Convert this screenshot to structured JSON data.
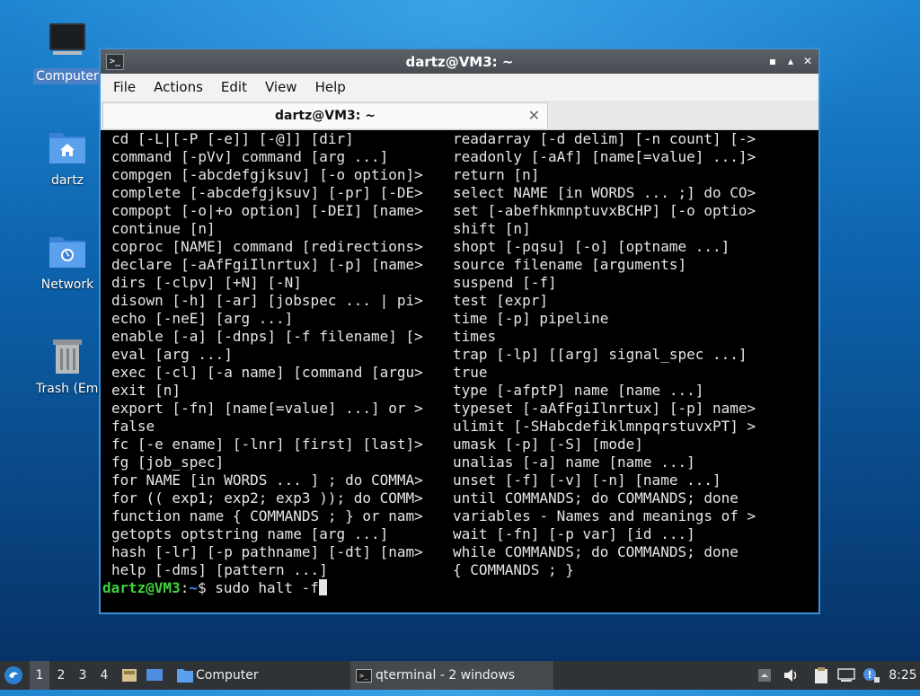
{
  "desktop": {
    "icons": [
      {
        "label": "Computer",
        "icon": "computer-icon",
        "selected": true
      },
      {
        "label": "dartz",
        "icon": "home-folder-icon"
      },
      {
        "label": "Network",
        "icon": "network-folder-icon"
      },
      {
        "label": "Trash (Empt",
        "icon": "trash-icon"
      }
    ]
  },
  "window": {
    "title": "dartz@VM3: ~",
    "controls": {
      "minimize": "▪",
      "maximize": "▴",
      "close": "✕"
    },
    "menu": [
      "File",
      "Actions",
      "Edit",
      "View",
      "Help"
    ],
    "tab": {
      "label": "dartz@VM3: ~",
      "close": "✕"
    }
  },
  "terminal": {
    "left_column": [
      "cd [-L|[-P [-e]] [-@]] [dir]",
      "command [-pVv] command [arg ...]",
      "compgen [-abcdefgjksuv] [-o option]>",
      "complete [-abcdefgjksuv] [-pr] [-DE>",
      "compopt [-o|+o option] [-DEI] [name>",
      "continue [n]",
      "coproc [NAME] command [redirections>",
      "declare [-aAfFgiIlnrtux] [-p] [name>",
      "dirs [-clpv] [+N] [-N]",
      "disown [-h] [-ar] [jobspec ... | pi>",
      "echo [-neE] [arg ...]",
      "enable [-a] [-dnps] [-f filename] [>",
      "eval [arg ...]",
      "exec [-cl] [-a name] [command [argu>",
      "exit [n]",
      "export [-fn] [name[=value] ...] or >",
      "false",
      "fc [-e ename] [-lnr] [first] [last]>",
      "fg [job_spec]",
      "for NAME [in WORDS ... ] ; do COMMA>",
      "for (( exp1; exp2; exp3 )); do COMM>",
      "function name { COMMANDS ; } or nam>",
      "getopts optstring name [arg ...]",
      "hash [-lr] [-p pathname] [-dt] [nam>",
      "help [-dms] [pattern ...]"
    ],
    "right_column": [
      "readarray [-d delim] [-n count] [->",
      "readonly [-aAf] [name[=value] ...]>",
      "return [n]",
      "select NAME [in WORDS ... ;] do CO>",
      "set [-abefhkmnptuvxBCHP] [-o optio>",
      "shift [n]",
      "shopt [-pqsu] [-o] [optname ...]",
      "source filename [arguments]",
      "suspend [-f]",
      "test [expr]",
      "time [-p] pipeline",
      "times",
      "trap [-lp] [[arg] signal_spec ...]",
      "true",
      "type [-afptP] name [name ...]",
      "typeset [-aAfFgiIlnrtux] [-p] name>",
      "ulimit [-SHabcdefiklmnpqrstuvxPT] >",
      "umask [-p] [-S] [mode]",
      "unalias [-a] name [name ...]",
      "unset [-f] [-v] [-n] [name ...]",
      "until COMMANDS; do COMMANDS; done",
      "variables - Names and meanings of >",
      "wait [-fn] [-p var] [id ...]",
      "while COMMANDS; do COMMANDS; done",
      "{ COMMANDS ; }"
    ],
    "prompt": {
      "user_host": "dartz@VM3",
      "separator": ":",
      "path": "~",
      "symbol": "$",
      "command": " sudo halt -f"
    }
  },
  "taskbar": {
    "workspaces": [
      "1",
      "2",
      "3",
      "4"
    ],
    "active_workspace": "1",
    "launcher_computer": "Computer",
    "task": "qterminal - 2 windows",
    "clock": "8:25",
    "colors": {
      "bar": "#2f3336",
      "active": "#4a5055"
    }
  }
}
